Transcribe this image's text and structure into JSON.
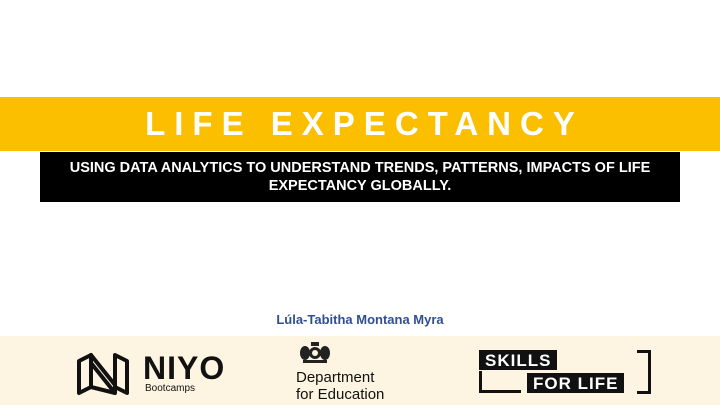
{
  "slide": {
    "title": "LIFE EXPECTANCY",
    "subtitle": "USING DATA ANALYTICS TO UNDERSTAND TRENDS, PATTERNS, IMPACTS OF LIFE EXPECTANCY GLOBALLY.",
    "author": "Lúla-Tabitha Montana Myra"
  },
  "footer": {
    "niyo": {
      "name": "NIYO",
      "sub": "Bootcamps",
      "icon": "niyo-logo-icon"
    },
    "dfe": {
      "line1": "Department",
      "line2": "for Education",
      "icon": "royal-crest-icon"
    },
    "skills": {
      "line1": "SKILLS",
      "line2": "FOR LIFE"
    }
  },
  "colors": {
    "title_band": "#fbbf00",
    "subtitle_band": "#000000",
    "author_text": "#2f4f8f",
    "footer_band": "#fdf4e1"
  }
}
